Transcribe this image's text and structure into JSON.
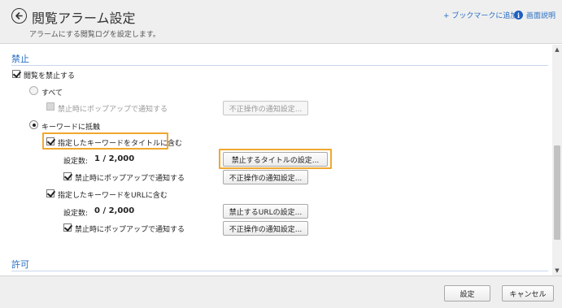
{
  "header": {
    "title": "閲覧アラーム設定",
    "subtitle": "アラームにする閲覧ログを設定します。",
    "bookmark_link": "+ ブックマークに追加",
    "help_link": "画面説明",
    "info_icon_glyph": "i"
  },
  "prohibit": {
    "section_title": "禁止",
    "block_browsing_label": "閲覧を禁止する",
    "all": {
      "label": "すべて",
      "popup_label": "禁止時にポップアップで通知する",
      "notify_button": "不正操作の通知設定..."
    },
    "keyword": {
      "label": "キーワードに抵触",
      "title_rule": {
        "label": "指定したキーワードをタイトルに含む",
        "count_label": "設定数:",
        "count_value": "1 / 2,000",
        "settings_button": "禁止するタイトルの設定...",
        "popup_label": "禁止時にポップアップで通知する",
        "notify_button": "不正操作の通知設定..."
      },
      "url_rule": {
        "label": "指定したキーワードをURLに含む",
        "count_label": "設定数:",
        "count_value": "0 / 2,000",
        "settings_button": "禁止するURLの設定...",
        "popup_label": "禁止時にポップアップで通知する",
        "notify_button": "不正操作の通知設定..."
      }
    }
  },
  "allow": {
    "section_title": "許可"
  },
  "footer": {
    "ok_button": "設定",
    "cancel_button": "キャンセル"
  },
  "colors": {
    "accent": "#2a6fc4",
    "highlight": "#f0a830",
    "header_bg": "#efefef"
  },
  "icons": {
    "back": "back-arrow-circle-icon",
    "info": "info-icon"
  }
}
